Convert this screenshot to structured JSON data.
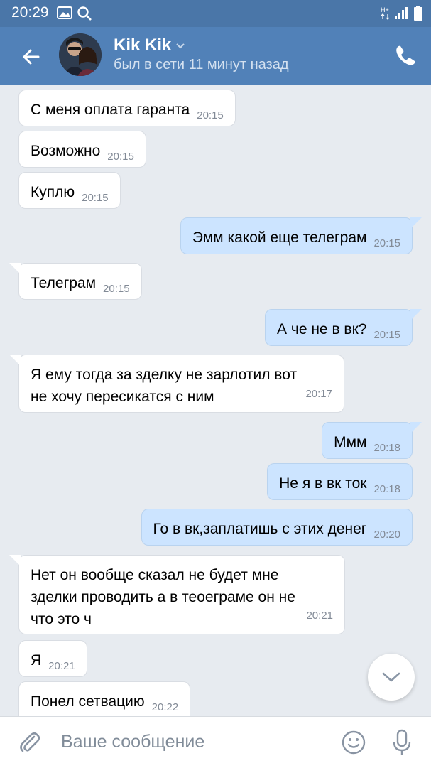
{
  "status": {
    "time": "20:29"
  },
  "header": {
    "name": "Kik Kik",
    "last_seen": "был в сети 11 минут назад"
  },
  "messages": [
    {
      "dir": "in",
      "text": "С меня оплата гаранта",
      "time": "20:15"
    },
    {
      "dir": "in",
      "text": "Возможно",
      "time": "20:15"
    },
    {
      "dir": "in",
      "text": "Куплю",
      "time": "20:15"
    },
    {
      "dir": "out",
      "text": "Эмм какой еще телеграм",
      "time": "20:15"
    },
    {
      "dir": "in",
      "text": "Телеграм",
      "time": "20:15"
    },
    {
      "dir": "out",
      "text": "А че не в вк?",
      "time": "20:15"
    },
    {
      "dir": "in",
      "line1": "Я ему тогда за зделку не зарлотил вот",
      "line2": "не хочу пересикатся с ним",
      "time": "20:17"
    },
    {
      "dir": "out",
      "text": "Ммм",
      "time": "20:18"
    },
    {
      "dir": "out",
      "text": "Не я в вк ток",
      "time": "20:18"
    },
    {
      "dir": "out",
      "text": "Го в вк,заплатишь с этих денег",
      "time": "20:20"
    },
    {
      "dir": "in",
      "line1": "Нет он вообще сказал не будет мне",
      "line2": "зделки проводить а в теоеграме он не",
      "line3": "что это ч",
      "time": "20:21"
    },
    {
      "dir": "in",
      "text": "Я",
      "time": "20:21"
    },
    {
      "dir": "in",
      "text": "Понел сетвацию",
      "time": "20:22"
    }
  ],
  "composer": {
    "placeholder": "Ваше сообщение"
  },
  "icons": {
    "back": "arrow-left-icon",
    "phone": "phone-icon",
    "attach": "paperclip-icon",
    "emoji": "smiley-icon",
    "mic": "microphone-icon",
    "scroll": "chevron-down-icon"
  },
  "colors": {
    "header": "#5181b8",
    "statusbar": "#4a76a8",
    "incoming": "#ffffff",
    "outgoing": "#cce4ff",
    "background": "#e7ebf0"
  }
}
